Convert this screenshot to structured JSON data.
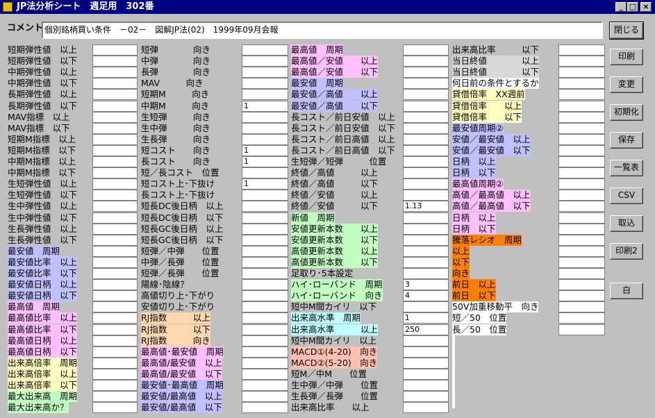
{
  "window": {
    "title": "JP法分析シート　週足用　302番",
    "minimize_glyph": "_",
    "maximize_glyph": "□",
    "close_glyph": "×"
  },
  "comment": {
    "label": "コメント",
    "value": "個別銘柄買い条件　－02－　図解JP法(02)　1999年09月会報"
  },
  "buttons": [
    "閉じる",
    "印刷",
    "変更",
    "初期化",
    "保存",
    "一覧表",
    "CSV",
    "取込",
    "印刷2",
    "白"
  ],
  "colors": {
    "blue": "#c0c0ff",
    "pink": "#ffc0ff",
    "yellow": "#ffffc0",
    "green": "#c0ffc0",
    "peach": "#ffd8b0",
    "salmon": "#ffc0b0",
    "cyan": "#c0ffff",
    "orange": "#ff8000",
    "white": "#ffffff",
    "grey": "#d8d8d8"
  },
  "columns": [
    {
      "rows": [
        {
          "label": "短期弾性値　以上",
          "value": ""
        },
        {
          "label": "短期弾性値　以下",
          "value": ""
        },
        {
          "label": "中期弾性値　以上",
          "value": ""
        },
        {
          "label": "中期弾性値　以下",
          "value": ""
        },
        {
          "label": "長期弾性値　以上",
          "value": ""
        },
        {
          "label": "長期弾性値　以下",
          "value": ""
        },
        {
          "label": "MAV指標　以上",
          "value": ""
        },
        {
          "label": "MAV指標　以下",
          "value": ""
        },
        {
          "label": "短期M指標　以上",
          "value": ""
        },
        {
          "label": "短期M指標　以下",
          "value": ""
        },
        {
          "label": "中期M指標　以上",
          "value": ""
        },
        {
          "label": "中期M指標　以下",
          "value": ""
        },
        {
          "label": "生短弾性値　以上",
          "value": ""
        },
        {
          "label": "生短弾性値　以下",
          "value": ""
        },
        {
          "label": "生中弾性値　以上",
          "value": ""
        },
        {
          "label": "生中弾性値　以下",
          "value": ""
        },
        {
          "label": "生長弾性値　以上",
          "value": ""
        },
        {
          "label": "生長弾性値　以下",
          "value": ""
        },
        {
          "label": "最安値　周期",
          "value": "",
          "color": "blue"
        },
        {
          "label": "最安値比率　以上",
          "value": "",
          "color": "blue"
        },
        {
          "label": "最安値比率　以下",
          "value": "",
          "color": "blue"
        },
        {
          "label": "最安値日柄　以上",
          "value": "",
          "color": "blue"
        },
        {
          "label": "最安値日柄　以下",
          "value": "",
          "color": "blue"
        },
        {
          "label": "最高値　周期",
          "value": "",
          "color": "pink"
        },
        {
          "label": "最高値比率　以上",
          "value": "",
          "color": "pink"
        },
        {
          "label": "最高値比率　以下",
          "value": "",
          "color": "pink"
        },
        {
          "label": "最高値日柄　以上",
          "value": "",
          "color": "pink"
        },
        {
          "label": "最高値日柄　以下",
          "value": "",
          "color": "pink"
        },
        {
          "label": "出来高倍率　周期",
          "value": "",
          "color": "yellow"
        },
        {
          "label": "出来高倍率　以上",
          "value": "",
          "color": "yellow"
        },
        {
          "label": "出来高倍率　以下",
          "value": "",
          "color": "yellow"
        },
        {
          "label": "最大出来高　周期",
          "value": "",
          "color": "green"
        },
        {
          "label": "最大出来高か？",
          "value": "",
          "color": "green"
        }
      ]
    },
    {
      "rows": [
        {
          "label": "短弾　　　　向き",
          "value": ""
        },
        {
          "label": "中弾　　　　向き",
          "value": ""
        },
        {
          "label": "長弾　　　　向き",
          "value": ""
        },
        {
          "label": "MAV　　　向き",
          "value": ""
        },
        {
          "label": "短期M　　　向き",
          "value": ""
        },
        {
          "label": "中期M　　　向き",
          "value": "1"
        },
        {
          "label": "生短弾　　　向き",
          "value": ""
        },
        {
          "label": "生中弾　　　向き",
          "value": ""
        },
        {
          "label": "生長弾　　　向き",
          "value": ""
        },
        {
          "label": "短コスト　　向き",
          "value": "1"
        },
        {
          "label": "長コスト　　向き",
          "value": "1"
        },
        {
          "label": "短／長コスト　位置",
          "value": ""
        },
        {
          "label": "短コスト上･下抜け",
          "value": "1"
        },
        {
          "label": "長コスト上･下抜け",
          "value": ""
        },
        {
          "label": "短長DC後日柄　以上",
          "value": ""
        },
        {
          "label": "短長DC後日柄　以下",
          "value": ""
        },
        {
          "label": "短長GC後日柄　以上",
          "value": ""
        },
        {
          "label": "短長GC後日柄　以下",
          "value": ""
        },
        {
          "label": "短弾／中弾　　位置",
          "value": ""
        },
        {
          "label": "中弾／長弾　　位置",
          "value": ""
        },
        {
          "label": "短弾／長弾　　位置",
          "value": ""
        },
        {
          "label": "陽線･陰線？",
          "value": ""
        },
        {
          "label": "高値切り上･下がり",
          "value": ""
        },
        {
          "label": "安値切り上･下がり",
          "value": ""
        },
        {
          "label": "RJ指数　　　以上",
          "value": "",
          "color": "peach"
        },
        {
          "label": "RJ指数　　　以下",
          "value": "",
          "color": "peach"
        },
        {
          "label": "RJ指数　　　向き",
          "value": "",
          "color": "peach"
        },
        {
          "label": "最高値･最安値　周期",
          "value": "",
          "color": "pink"
        },
        {
          "label": "最高値/最安値　以上",
          "value": "",
          "color": "pink"
        },
        {
          "label": "最高値/最安値　以下",
          "value": "",
          "color": "pink"
        },
        {
          "label": "最安値･最高値　周期",
          "value": "",
          "color": "blue"
        },
        {
          "label": "最安値/最高値　以上",
          "value": "",
          "color": "blue"
        },
        {
          "label": "最安値/最高値　以下",
          "value": "",
          "color": "blue"
        }
      ]
    },
    {
      "rows": [
        {
          "label": "最高値　周期",
          "value": "",
          "color": "pink"
        },
        {
          "label": "最高値／安値　　以上",
          "value": "",
          "color": "pink"
        },
        {
          "label": "最高値／安値　　以下",
          "value": "",
          "color": "pink"
        },
        {
          "label": "最安値　周期",
          "value": "",
          "color": "blue"
        },
        {
          "label": "最安値／高値　　以上",
          "value": "",
          "color": "blue"
        },
        {
          "label": "最安値／高値　　以下",
          "value": "",
          "color": "blue"
        },
        {
          "label": "長コスト／前日安値　以上",
          "value": ""
        },
        {
          "label": "長コスト／前日安値　以下",
          "value": ""
        },
        {
          "label": "長コスト／前日高値　以上",
          "value": ""
        },
        {
          "label": "長コスト／前日高値　以下",
          "value": ""
        },
        {
          "label": "生短弾／短弾　　　位置",
          "value": ""
        },
        {
          "label": "終値／高値　　　以上",
          "value": ""
        },
        {
          "label": "終値／高値　　　以下",
          "value": ""
        },
        {
          "label": "終値／安値　　　以上",
          "value": ""
        },
        {
          "label": "終値／安値　　　以下",
          "value": "1.13"
        },
        {
          "label": "新値　周期",
          "value": "",
          "color": "green"
        },
        {
          "label": "安値更新本数　　以上",
          "value": "",
          "color": "green"
        },
        {
          "label": "安値更新本数　　以下",
          "value": "",
          "color": "green"
        },
        {
          "label": "高値更新本数　　以上",
          "value": "",
          "color": "green"
        },
        {
          "label": "高値更新本数　　以下",
          "value": "",
          "color": "green"
        },
        {
          "label": "足取り･5本設定",
          "value": ""
        },
        {
          "label": "ハイ･ローバンド　周期",
          "value": "3",
          "color": "green"
        },
        {
          "label": "ハイ･ローバンド　向き",
          "value": "4",
          "color": "green"
        },
        {
          "label": "短中M間カイリ　以下",
          "value": ""
        },
        {
          "label": "出来高水準　周期",
          "value": "1",
          "color": "cyan"
        },
        {
          "label": "出来高水準　　　以上",
          "value": "250",
          "color": "cyan"
        },
        {
          "label": "短中M間カイリ　以上",
          "value": ""
        },
        {
          "label": "MACD①(4-20)　向き",
          "value": "",
          "color": "salmon"
        },
        {
          "label": "MACD②(5-20)　向き",
          "value": "",
          "color": "salmon"
        },
        {
          "label": "短M／中M　　位置",
          "value": ""
        },
        {
          "label": "生中弾／中弾　　位置",
          "value": ""
        },
        {
          "label": "生長弾／長弾　　位置",
          "value": ""
        },
        {
          "label": "出来高比率　　以上",
          "value": ""
        }
      ]
    },
    {
      "rows": [
        {
          "label": "出来高比率　　　以下",
          "value": ""
        },
        {
          "label": "当日終値　　　　以上",
          "value": "",
          "color": "grey"
        },
        {
          "label": "当日終値　　　　以下",
          "value": "",
          "color": "grey"
        },
        {
          "label": "何日前の条件とするか",
          "value": "",
          "color": "white"
        },
        {
          "label": "貸借倍率　XX週前",
          "value": "",
          "color": "yellow"
        },
        {
          "label": "貸借倍率　　以上",
          "value": "",
          "color": "yellow"
        },
        {
          "label": "貸借倍率　　以下",
          "value": "",
          "color": "yellow"
        },
        {
          "label": "最安値周期②",
          "value": "",
          "color": "blue"
        },
        {
          "label": "安値／最安値　以上",
          "value": "",
          "color": "blue"
        },
        {
          "label": "安値／最安値　以下",
          "value": "",
          "color": "blue"
        },
        {
          "label": "日柄　以上",
          "value": "",
          "color": "blue"
        },
        {
          "label": "日柄　以下",
          "value": "",
          "color": "blue"
        },
        {
          "label": "最高値周期②",
          "value": "",
          "color": "pink"
        },
        {
          "label": "高値／最高値　以上",
          "value": "",
          "color": "pink"
        },
        {
          "label": "高値／最高値　以下",
          "value": "",
          "color": "pink"
        },
        {
          "label": "日柄　以上",
          "value": "",
          "color": "pink"
        },
        {
          "label": "日柄　以下",
          "value": "",
          "color": "pink"
        },
        {
          "label": "騰落レシオ　周期",
          "value": "",
          "color": "orange"
        },
        {
          "label": "以上",
          "value": "",
          "color": "orange"
        },
        {
          "label": "以下",
          "value": "",
          "color": "orange"
        },
        {
          "label": "向き",
          "value": "",
          "color": "orange"
        },
        {
          "label": "前日　以上",
          "value": "",
          "color": "orange"
        },
        {
          "label": "前日　以下",
          "value": "",
          "color": "orange"
        },
        {
          "label": "50V加重移動平　向き",
          "value": "",
          "color": "white"
        },
        {
          "label": "短／50　位置",
          "value": "",
          "color": "white"
        },
        {
          "label": "長／50　位置",
          "value": "",
          "color": "white"
        }
      ]
    }
  ]
}
